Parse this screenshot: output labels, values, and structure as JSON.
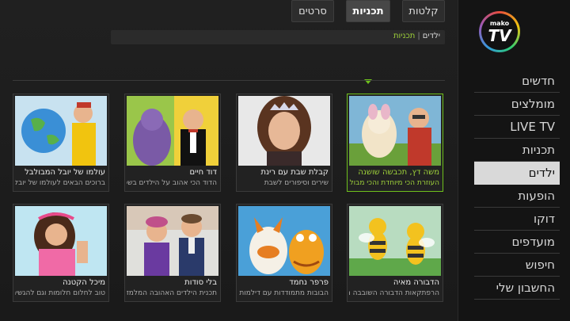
{
  "logo": {
    "top_text": "mako",
    "main_text": "TV"
  },
  "breadcrumb": {
    "first": "ילדים",
    "separator": "|",
    "current": "תכניות"
  },
  "tabs": [
    "קלטות",
    "תכניות",
    "סרטים"
  ],
  "nav": [
    "חדשים",
    "מומלצים",
    "LIVE TV",
    "תכניות",
    "ילדים",
    "הופעות",
    "דוקו",
    "מועדפים",
    "חיפוש",
    "החשבון שלי"
  ],
  "cards": [
    {
      "title": "משה דץ, תכבשה שושנה",
      "subtitle": "העוזרת הכי מיוחדת והכי מבולב..."
    },
    {
      "title": "קבלת שבת עם רינת",
      "subtitle": "שירים וסיפורים לשבת"
    },
    {
      "title": "דוד חיים",
      "subtitle": "הדוד הכי אהוב על הילדים בשכו..."
    },
    {
      "title": "עולמו של יובל המבולבל",
      "subtitle": "ברוכים הבאים לעולמו של יובל..."
    },
    {
      "title": "הדבורה מאיה",
      "subtitle": "הרפתקאות הדבורה השובבה מ..."
    },
    {
      "title": "פרפר נחמד",
      "subtitle": "הבובות מתמודדות עם דילמות"
    },
    {
      "title": "בלי סודות",
      "subtitle": "תכנית הילדים האהובה המלמד..."
    },
    {
      "title": "מיכל הקטנה",
      "subtitle": "טוב לחלום חלומות וגם להגשים..."
    }
  ],
  "colors": {
    "accent": "#6ec01c",
    "active_nav_bg": "#d9d9d9"
  }
}
